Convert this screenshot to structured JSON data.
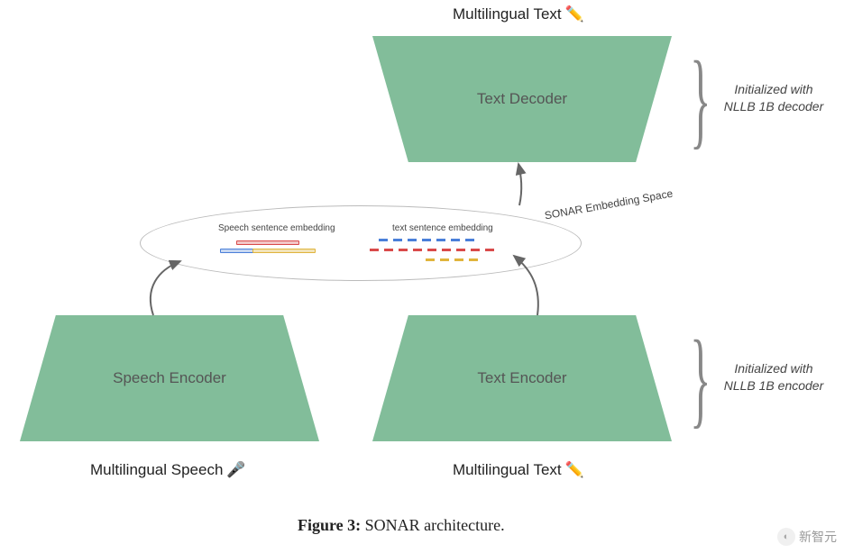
{
  "caption": {
    "prefix": "Figure 3:",
    "text": " SONAR architecture."
  },
  "blocks": {
    "text_decoder": "Text Decoder",
    "speech_encoder": "Speech Encoder",
    "text_encoder": "Text Encoder"
  },
  "labels": {
    "top_text": "Multilingual Text",
    "bottom_text": "Multilingual Text",
    "bottom_speech": "Multilingual Speech"
  },
  "embedding": {
    "space_label": "SONAR Embedding Space",
    "speech_label": "Speech sentence embedding",
    "text_label": "text sentence embedding"
  },
  "annotations": {
    "decoder": "Initialized with NLLB 1B decoder",
    "encoder": "Initialized with NLLB 1B encoder"
  },
  "icons": {
    "pencil": "✏️",
    "mic": "🎤"
  },
  "watermark": "新智元",
  "colors": {
    "block": "#82BD9A",
    "red": "#D94A4A",
    "blue": "#4A7FD9",
    "yellow": "#E0B43C"
  }
}
